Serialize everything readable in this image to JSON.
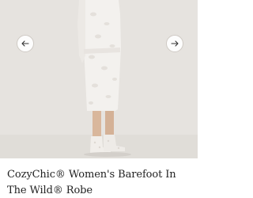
{
  "product": {
    "title": "CozyChic® Women's Barefoot In The Wild® Robe"
  },
  "carousel": {
    "prev_icon": "arrow-left-icon",
    "next_icon": "arrow-right-icon"
  },
  "colors": {
    "background": "#e6e3df",
    "robe": "#f2efec",
    "text": "#222222"
  }
}
